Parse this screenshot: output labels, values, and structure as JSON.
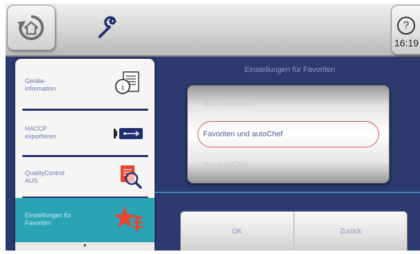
{
  "topbar": {
    "home_icon": "home-back-icon",
    "tool_icon": "wrench-icon",
    "help_label": "?",
    "clock": "16:19"
  },
  "menu": {
    "items": [
      {
        "label": "Geräte-\ninformation",
        "icon": "document-info-icon"
      },
      {
        "label": "HACCP\nexportieren",
        "icon": "usb-export-icon"
      },
      {
        "label": "QualityControl\nAUS",
        "icon": "quality-search-icon"
      },
      {
        "label": "Einstellungen für\nFavoriten",
        "icon": "favorites-star-icon",
        "active": true
      }
    ],
    "scroll_glyph": "▼"
  },
  "panel": {
    "title": "Einstellungen für Favoriten",
    "options": [
      {
        "label": "Nur Favoriten",
        "selected": false
      },
      {
        "label": "Favoriten und autoChef",
        "selected": true
      },
      {
        "label": "Nur autoChef",
        "selected": false
      }
    ],
    "ok_label": "OK",
    "back_label": "Zurück"
  },
  "colors": {
    "background": "#2c3a70",
    "menu_active": "#2aa4b5",
    "selection_ring": "#d8554b",
    "accent_line": "#3e84b6"
  }
}
